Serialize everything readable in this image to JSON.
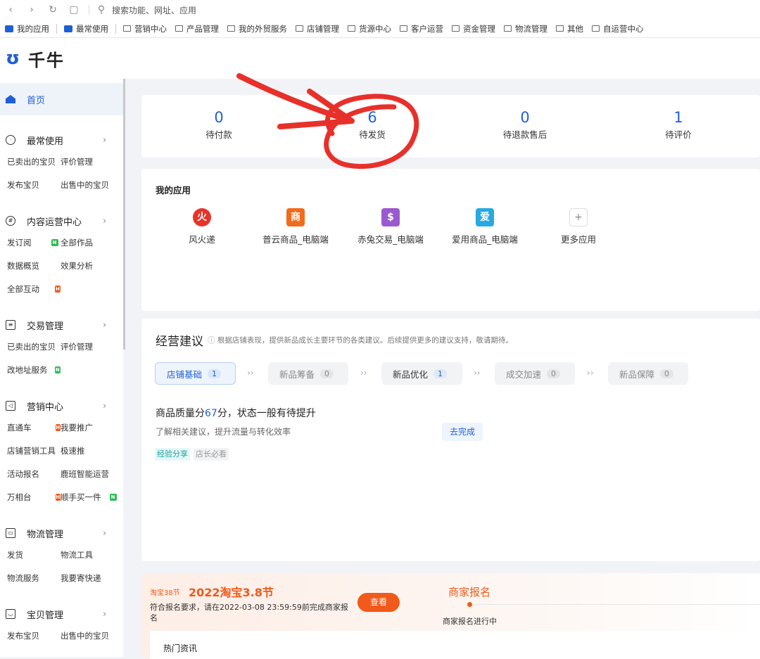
{
  "browser": {
    "search_placeholder": "搜索功能、网址、应用"
  },
  "bookmarks": [
    {
      "label": "我的应用",
      "icon": "app-icon"
    },
    {
      "label": "最常使用",
      "icon": "app-icon"
    },
    {
      "label": "营销中心",
      "icon": "folder-icon"
    },
    {
      "label": "产品管理",
      "icon": "folder-icon"
    },
    {
      "label": "我的外贸服务",
      "icon": "folder-icon"
    },
    {
      "label": "店铺管理",
      "icon": "folder-icon"
    },
    {
      "label": "货源中心",
      "icon": "folder-icon"
    },
    {
      "label": "客户运营",
      "icon": "folder-icon"
    },
    {
      "label": "资金管理",
      "icon": "folder-icon"
    },
    {
      "label": "物流管理",
      "icon": "folder-icon"
    },
    {
      "label": "其他",
      "icon": "folder-icon"
    },
    {
      "label": "自运营中心",
      "icon": "folder-icon"
    }
  ],
  "brand": {
    "name": "千牛",
    "color": "#1f5fd6"
  },
  "sidebar": {
    "home": "首页",
    "sections": [
      {
        "title": "最常使用",
        "icon": "clock-icon",
        "rows": [
          [
            "已卖出的宝贝",
            "评价管理"
          ],
          [
            "发布宝贝",
            "出售中的宝贝"
          ]
        ]
      },
      {
        "title": "内容运营中心",
        "icon": "hash-icon",
        "rows": [
          [
            "发订阅",
            "全部作品"
          ],
          [
            "数据概览",
            "效果分析"
          ],
          [
            "全部互动",
            ""
          ]
        ]
      },
      {
        "title": "交易管理",
        "icon": "clipboard-icon",
        "rows": [
          [
            "已卖出的宝贝",
            "评价管理"
          ],
          [
            "改地址服务",
            ""
          ]
        ]
      },
      {
        "title": "营销中心",
        "icon": "megaphone-icon",
        "rows": [
          [
            "直通车",
            "我要推广"
          ],
          [
            "店铺营销工具",
            "极速推"
          ],
          [
            "活动报名",
            "鹿班智能运营"
          ],
          [
            "万相台",
            "顺手买一件"
          ]
        ]
      },
      {
        "title": "物流管理",
        "icon": "box-icon",
        "rows": [
          [
            "发货",
            "物流工具"
          ],
          [
            "物流服务",
            "我要寄快递"
          ]
        ]
      },
      {
        "title": "宝贝管理",
        "icon": "bag-icon",
        "rows": [
          [
            "发布宝贝",
            "出售中的宝贝"
          ]
        ]
      }
    ]
  },
  "stats": [
    {
      "value": "0",
      "label": "待付款"
    },
    {
      "value": "6",
      "label": "待发货"
    },
    {
      "value": "0",
      "label": "待退款售后"
    },
    {
      "value": "1",
      "label": "待评价"
    }
  ],
  "apps": {
    "title": "我的应用",
    "items": [
      {
        "name": "风火递",
        "glyph": "火",
        "color": "#e8332a"
      },
      {
        "name": "普云商品_电脑端",
        "glyph": "商",
        "color": "#f26b1d"
      },
      {
        "name": "赤兔交易_电脑端",
        "glyph": "$",
        "color": "#9b59d0"
      },
      {
        "name": "爱用商品_电脑端",
        "glyph": "爱",
        "color": "#27a9e1"
      },
      {
        "name": "更多应用",
        "glyph": "+",
        "color": "#ffffff"
      }
    ]
  },
  "suggest": {
    "title": "经营建议",
    "subtitle": "根据店铺表现，提供新品成长主要环节的各类建议。后续提供更多的建议支持，敬请期待。",
    "steps": [
      {
        "label": "店铺基础",
        "count": "1"
      },
      {
        "label": "新品筹备",
        "count": "0"
      },
      {
        "label": "新品优化",
        "count": "1"
      },
      {
        "label": "成交加速",
        "count": "0"
      },
      {
        "label": "新品保障",
        "count": "0"
      }
    ],
    "separator": "››",
    "quality_prefix": "商品质量分",
    "quality_score": "67",
    "quality_suffix": "分，状态一般有待提升",
    "quality_sub": "了解相关建议，提升流量与转化效率",
    "action": "去完成",
    "tags": [
      "经验分享",
      "店长必看"
    ]
  },
  "promo": {
    "tag": "淘宝38节",
    "title": "2022淘宝3.8节",
    "desc": "符合报名要求，请在2022-03-08 23:59:59前完成商家报名",
    "button": "查看",
    "stage": "商家报名",
    "status": "商家报名进行中",
    "news_title": "热门资讯"
  }
}
